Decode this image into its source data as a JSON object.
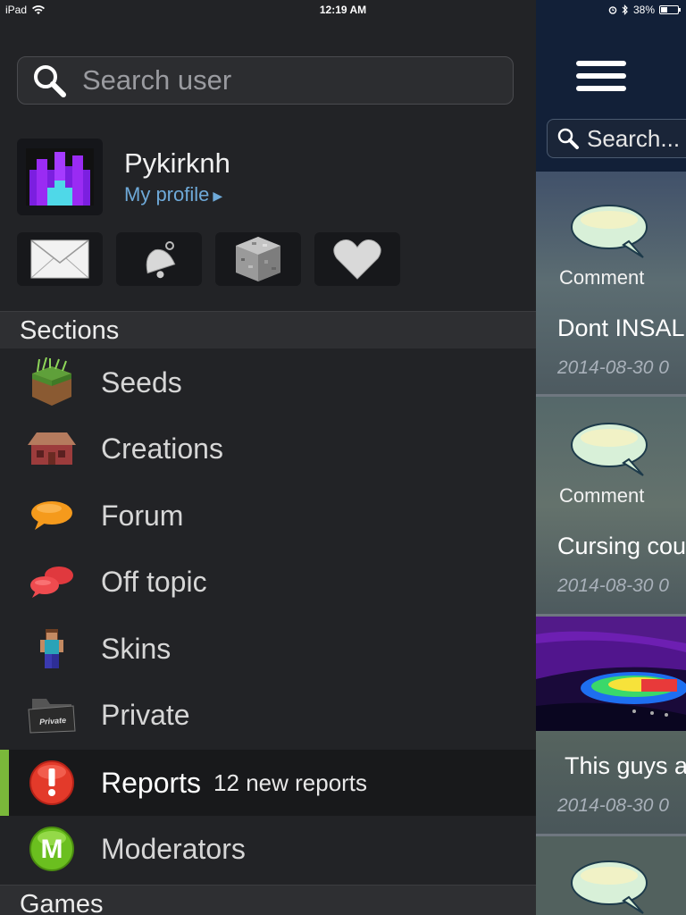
{
  "status_bar": {
    "device": "iPad",
    "time": "12:19 AM",
    "battery_text": "38%",
    "battery_level": 0.38
  },
  "drawer": {
    "search_placeholder": "Search user",
    "profile": {
      "name": "Pykirknh",
      "link_label": "My profile"
    },
    "quick_actions": [
      {
        "icon": "envelope-icon"
      },
      {
        "icon": "bell-icon"
      },
      {
        "icon": "stone-block-icon"
      },
      {
        "icon": "heart-icon"
      }
    ],
    "sections_header": "Sections",
    "sections": [
      {
        "label": "Seeds",
        "icon": "grass-block-icon"
      },
      {
        "label": "Creations",
        "icon": "house-icon"
      },
      {
        "label": "Forum",
        "icon": "speech-bubble-icon"
      },
      {
        "label": "Off topic",
        "icon": "double-bubble-icon"
      },
      {
        "label": "Skins",
        "icon": "character-icon"
      },
      {
        "label": "Private",
        "icon": "private-folder-icon"
      },
      {
        "label": "Reports",
        "icon": "alert-icon",
        "extra": "12 new reports",
        "active": true
      },
      {
        "label": "Moderators",
        "icon": "moderator-m-icon"
      }
    ],
    "games_header": "Games"
  },
  "panel": {
    "search_placeholder": "Search...",
    "cards": [
      {
        "type": "Comment",
        "title": "Dont INSAL",
        "date": "2014-08-30 0"
      },
      {
        "type": "Comment",
        "title": "Cursing cou",
        "date": "2014-08-30 0"
      },
      {
        "type": "",
        "title": "This guys a",
        "date": "2014-08-30 0"
      }
    ]
  },
  "colors": {
    "accent_active": "#7ab83a",
    "link": "#6ea9d8",
    "alert": "#e33a2a",
    "moderator": "#6bbf1f"
  }
}
